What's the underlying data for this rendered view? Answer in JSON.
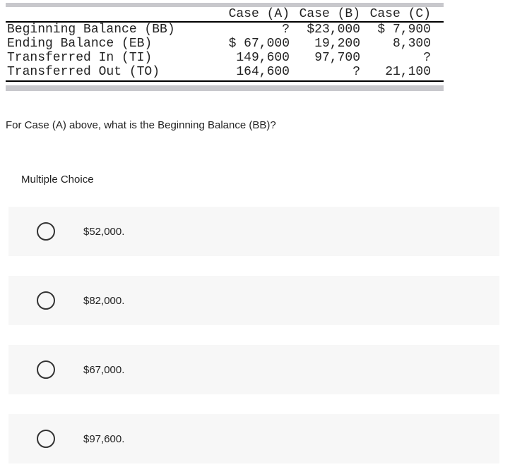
{
  "table": {
    "headers": {
      "blank": "",
      "caseA": "Case (A)",
      "caseB": "Case (B)",
      "caseC": "Case (C)"
    },
    "rows": [
      {
        "label": "Beginning Balance (BB)",
        "a": "?",
        "b": "$23,000",
        "c": "$ 7,900"
      },
      {
        "label": "Ending Balance (EB)",
        "a": "$ 67,000",
        "b": "19,200",
        "c": "8,300"
      },
      {
        "label": "Transferred In (TI)",
        "a": "149,600",
        "b": "97,700",
        "c": "?"
      },
      {
        "label": "Transferred Out (TO)",
        "a": "164,600",
        "b": "?",
        "c": "21,100"
      }
    ]
  },
  "question": "For Case (A) above, what is the Beginning Balance (BB)?",
  "mc_heading": "Multiple Choice",
  "options": [
    "$52,000.",
    "$82,000.",
    "$67,000.",
    "$97,600."
  ]
}
